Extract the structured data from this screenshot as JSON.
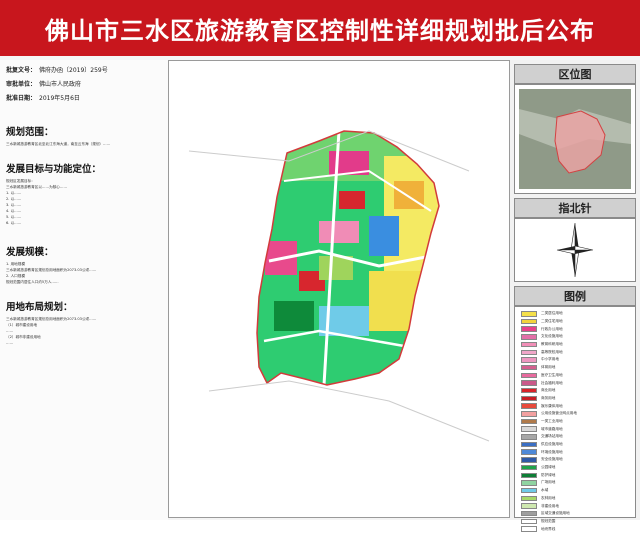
{
  "title": "佛山市三水区旅游教育区控制性详细规划批后公布",
  "meta": [
    {
      "label": "批复文号：",
      "value": "佛府办函〔2019〕259号"
    },
    {
      "label": "审批单位：",
      "value": "佛山市人民政府"
    },
    {
      "label": "批准日期：",
      "value": "2019年5月6日"
    }
  ],
  "sections": {
    "scope": {
      "heading": "规划范围：",
      "text": "三水新城旅游教育区北至北江东海大道，南至云东海（规划）……"
    },
    "goals": {
      "heading": "发展目标与功能定位：",
      "text": "规划区发展目标：\n三水新城旅游教育区以……为核心……\n1. 以……\n2. 以……\n3. 以……\n4. 以……\n5. 以……\n6. 以……"
    },
    "scale": {
      "heading": "发展规模：",
      "text": "1. 用地规模\n三水新城旅游教育区规划总用地面积为2073.03公顷……\n2. 人口规模\n规划范围内居住人口约5万人……"
    },
    "landuse": {
      "heading": "用地布局规划：",
      "text": "三水新城旅游教育区规划总用地面积为2073.03公顷……\n（1）城市建设用地\n……\n（2）城市非建设用地\n……"
    }
  },
  "right": {
    "location_title": "区位图",
    "north_title": "指北针",
    "legend_title": "图例"
  },
  "legend": [
    {
      "label": "二类居住用地",
      "color": "#f5e04a"
    },
    {
      "label": "二类住宅用地",
      "color": "#f3d33c"
    },
    {
      "label": "行政办公用地",
      "color": "#e8418a"
    },
    {
      "label": "文化设施用地",
      "color": "#e36fa8"
    },
    {
      "label": "教育科研用地",
      "color": "#f28fb8"
    },
    {
      "label": "高等院校用地",
      "color": "#f0a6c8"
    },
    {
      "label": "中小学用地",
      "color": "#ee97c0"
    },
    {
      "label": "体育用地",
      "color": "#d4608f"
    },
    {
      "label": "医疗卫生用地",
      "color": "#e86a9e"
    },
    {
      "label": "社会福利用地",
      "color": "#c95a8a"
    },
    {
      "label": "商业用地",
      "color": "#d8232a"
    },
    {
      "label": "商务用地",
      "color": "#c81e26"
    },
    {
      "label": "娱乐康体用地",
      "color": "#e84a3c"
    },
    {
      "label": "公用设施营业网点用地",
      "color": "#f2a0a0"
    },
    {
      "label": "一类工业用地",
      "color": "#b07a4a"
    },
    {
      "label": "城市道路用地",
      "color": "#d8d8d8"
    },
    {
      "label": "交通场站用地",
      "color": "#a7a7a7"
    },
    {
      "label": "供应设施用地",
      "color": "#3b6fc4"
    },
    {
      "label": "环境设施用地",
      "color": "#4e89d8"
    },
    {
      "label": "安全设施用地",
      "color": "#2f5aa6"
    },
    {
      "label": "公园绿地",
      "color": "#1fa34a"
    },
    {
      "label": "防护绿地",
      "color": "#0e7e36"
    },
    {
      "label": "广场用地",
      "color": "#8fd3a1"
    },
    {
      "label": "水域",
      "color": "#6fcbe8"
    },
    {
      "label": "农林用地",
      "color": "#a7d86a"
    },
    {
      "label": "非建设用地",
      "color": "#cfe9b0"
    },
    {
      "label": "区域交通设施用地",
      "color": "#9e9e9e"
    },
    {
      "label": "规划范围",
      "color": "#ffffff"
    },
    {
      "label": "地块界线",
      "color": "#ffffff"
    }
  ]
}
